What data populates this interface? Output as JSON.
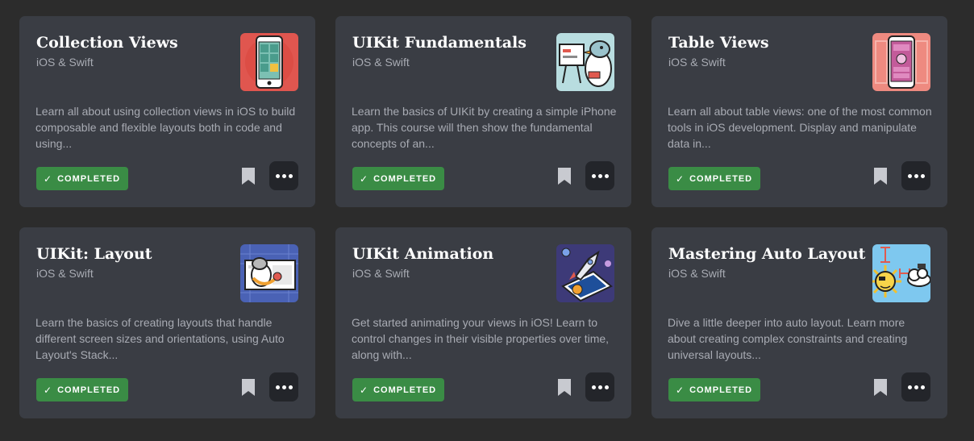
{
  "courses": [
    {
      "title": "Collection Views",
      "subtitle": "iOS & Swift",
      "description": "Learn all about using collection views in iOS to build composable and flexible layouts both in code and using...",
      "status": "COMPLETED",
      "thumbnail_icon": "phone-grid-illustration",
      "thumbnail_color": "#e0564f"
    },
    {
      "title": "UIKit Fundamentals",
      "subtitle": "iOS & Swift",
      "description": "Learn the basics of UIKit by creating a simple iPhone app. This course will then show the fundamental concepts of an...",
      "status": "COMPLETED",
      "thumbnail_icon": "bird-presenter-illustration",
      "thumbnail_color": "#b8dde0"
    },
    {
      "title": "Table Views",
      "subtitle": "iOS & Swift",
      "description": "Learn all about table views: one of the most common tools in iOS development. Display and manipulate data in...",
      "status": "COMPLETED",
      "thumbnail_icon": "phone-list-illustration",
      "thumbnail_color": "#ee8a80"
    },
    {
      "title": "UIKit: Layout",
      "subtitle": "iOS & Swift",
      "description": "Learn the basics of creating layouts that handle different screen sizes and orientations, using Auto Layout's Stack...",
      "status": "COMPLETED",
      "thumbnail_icon": "bird-layout-illustration",
      "thumbnail_color": "#4a62b5"
    },
    {
      "title": "UIKit Animation",
      "subtitle": "iOS & Swift",
      "description": "Get started animating your views in iOS! Learn to control changes in their visible properties over time, along with...",
      "status": "COMPLETED",
      "thumbnail_icon": "rocket-phone-illustration",
      "thumbnail_color": "#3d3a78"
    },
    {
      "title": "Mastering Auto Layout",
      "subtitle": "iOS & Swift",
      "description": "Dive a little deeper into auto layout. Learn more about creating complex constraints and creating universal layouts...",
      "status": "COMPLETED",
      "thumbnail_icon": "sun-cloud-illustration",
      "thumbnail_color": "#7ec8ef"
    }
  ],
  "icons": {
    "check": "check-icon",
    "bookmark": "bookmark-icon",
    "more": "more-options-icon"
  },
  "colors": {
    "background": "#2c2c2c",
    "card": "#3a3d44",
    "badge": "#3a8c45",
    "more_button": "#23252a"
  }
}
